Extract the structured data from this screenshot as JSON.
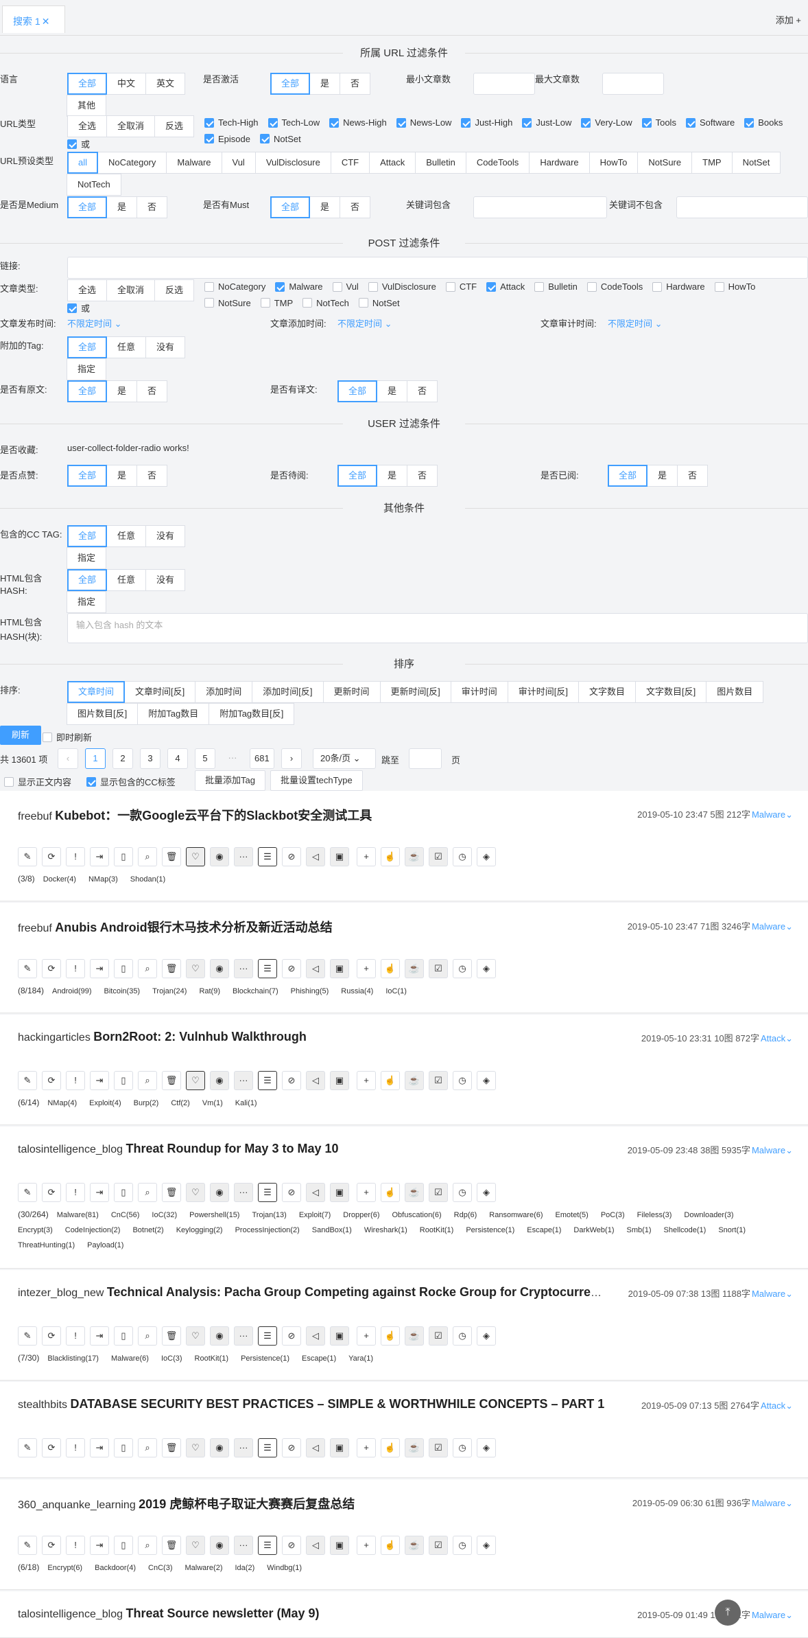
{
  "tab": {
    "label": "搜索 1",
    "close": "✕",
    "add": "添加 +"
  },
  "sections": {
    "url": "所属 URL 过滤条件",
    "post": "POST 过滤条件",
    "user": "USER 过滤条件",
    "other": "其他条件",
    "sort": "排序"
  },
  "url": {
    "lang_label": "语言",
    "lang": [
      "全部",
      "中文",
      "英文",
      "其他"
    ],
    "active_label": "是否激活",
    "active": [
      "全部",
      "是",
      "否"
    ],
    "min_label": "最小文章数",
    "max_label": "最大文章数",
    "type_label": "URL类型",
    "type_btns": [
      "全选",
      "全取消",
      "反选"
    ],
    "types": [
      "Tech-High",
      "Tech-Low",
      "News-High",
      "News-Low",
      "Just-High",
      "Just-Low",
      "Very-Low",
      "Tools",
      "Software",
      "Books",
      "Episode",
      "NotSet"
    ],
    "or": "或",
    "preset_label": "URL预设类型",
    "presets": [
      "all",
      "NoCategory",
      "Malware",
      "Vul",
      "VulDisclosure",
      "CTF",
      "Attack",
      "Bulletin",
      "CodeTools",
      "Hardware",
      "HowTo",
      "NotSure",
      "TMP",
      "NotSet",
      "NotTech"
    ],
    "medium_label": "是否是Medium",
    "medium": [
      "全部",
      "是",
      "否"
    ],
    "must_label": "是否有Must",
    "must": [
      "全部",
      "是",
      "否"
    ],
    "kw_in_label": "关键词包含",
    "kw_out_label": "关键词不包含"
  },
  "post": {
    "link_label": "链接:",
    "type_label": "文章类型:",
    "type_btns": [
      "全选",
      "全取消",
      "反选"
    ],
    "types": [
      "NoCategory",
      "Malware",
      "Vul",
      "VulDisclosure",
      "CTF",
      "Attack",
      "Bulletin",
      "CodeTools",
      "Hardware",
      "HowTo",
      "NotSure",
      "TMP",
      "NotTech",
      "NotSet"
    ],
    "or": "或",
    "pub_label": "文章发布时间:",
    "add_label": "文章添加时间:",
    "audit_label": "文章审计时间:",
    "unlimited": "不限定时间",
    "tag_label": "附加的Tag:",
    "tag": [
      "全部",
      "任意",
      "没有",
      "指定"
    ],
    "orig_label": "是否有原文:",
    "orig": [
      "全部",
      "是",
      "否"
    ],
    "trans_label": "是否有译文:",
    "trans": [
      "全部",
      "是",
      "否"
    ]
  },
  "user": {
    "collect_label": "是否收藏:",
    "collect_text": "user-collect-folder-radio works!",
    "like_label": "是否点赞:",
    "like": [
      "全部",
      "是",
      "否"
    ],
    "todo_label": "是否待阅:",
    "todo": [
      "全部",
      "是",
      "否"
    ],
    "read_label": "是否已阅:",
    "read": [
      "全部",
      "是",
      "否"
    ]
  },
  "other": {
    "cc_label": "包含的CC TAG:",
    "cc": [
      "全部",
      "任意",
      "没有",
      "指定"
    ],
    "hash_label1": "HTML包含",
    "hash_label2": "HASH:",
    "hash": [
      "全部",
      "任意",
      "没有",
      "指定"
    ],
    "hashb_label1": "HTML包含",
    "hashb_label2": "HASH(块):",
    "hashb_placeholder": "输入包含 hash 的文本"
  },
  "sort": {
    "label": "排序:",
    "opts": [
      "文章时间",
      "文章时间[反]",
      "添加时间",
      "添加时间[反]",
      "更新时间",
      "更新时间[反]",
      "审计时间",
      "审计时间[反]",
      "文字数目",
      "文字数目[反]",
      "图片数目",
      "图片数目[反]",
      "附加Tag数目",
      "附加Tag数目[反]"
    ]
  },
  "actions": {
    "refresh": "刷新",
    "instant": "即时刷新",
    "total": "共 13601 项",
    "pages": [
      "1",
      "2",
      "3",
      "4",
      "5",
      "···",
      "681"
    ],
    "per_page": "20条/页",
    "jump": "跳至",
    "page_suffix": "页",
    "show_body": "显示正文内容",
    "show_cc": "显示包含的CC标签",
    "batch_tag": "批量添加Tag",
    "batch_tech": "批量设置techType"
  },
  "icons": [
    "✎",
    "⟳",
    "!",
    "⇥",
    "▯",
    "⌕",
    "🗑",
    "♡",
    "◉",
    "···",
    "☰",
    "⊘",
    "◁",
    "▣",
    "+",
    "☝",
    "☕",
    "☑",
    "◷",
    "◈"
  ],
  "posts": [
    {
      "source": "freebuf",
      "title": "Kubebot：一款Google云平台下的Slackbot安全测试工具",
      "date": "2019-05-10 23:47",
      "imgs": "5图",
      "words": "212字",
      "cat": "Malware",
      "count": "(3/8)",
      "tags": [
        "Docker(4)",
        "NMap(3)",
        "Shodan(1)"
      ]
    },
    {
      "source": "freebuf",
      "title": "Anubis Android银行木马技术分析及新近活动总结",
      "date": "2019-05-10 23:47",
      "imgs": "71图",
      "words": "3246字",
      "cat": "Malware",
      "count": "(8/184)",
      "tags": [
        "Android(99)",
        "Bitcoin(35)",
        "Trojan(24)",
        "Rat(9)",
        "Blockchain(7)",
        "Phishing(5)",
        "Russia(4)",
        "IoC(1)"
      ]
    },
    {
      "source": "hackingarticles",
      "title": "Born2Root: 2: Vulnhub Walkthrough",
      "date": "2019-05-10 23:31",
      "imgs": "10图",
      "words": "872字",
      "cat": "Attack",
      "count": "(6/14)",
      "tags": [
        "NMap(4)",
        "Exploit(4)",
        "Burp(2)",
        "Ctf(2)",
        "Vm(1)",
        "Kali(1)"
      ]
    },
    {
      "source": "talosintelligence_blog",
      "title": "Threat Roundup for May 3 to May 10",
      "date": "2019-05-09 23:48",
      "imgs": "38图",
      "words": "5935字",
      "cat": "Malware",
      "count": "(30/264)",
      "tags": [
        "Malware(81)",
        "CnC(56)",
        "IoC(32)",
        "Powershell(15)",
        "Trojan(13)",
        "Exploit(7)",
        "Dropper(6)",
        "Obfuscation(6)",
        "Rdp(6)",
        "Ransomware(6)",
        "Emotet(5)",
        "PoC(3)",
        "Fileless(3)",
        "Downloader(3)",
        "Encrypt(3)",
        "CodeInjection(2)",
        "Botnet(2)",
        "Keylogging(2)",
        "ProcessInjection(2)",
        "SandBox(1)",
        "Wireshark(1)",
        "RootKit(1)",
        "Persistence(1)",
        "Escape(1)",
        "DarkWeb(1)",
        "Smb(1)",
        "Shellcode(1)",
        "Snort(1)",
        "ThreatHunting(1)",
        "Payload(1)"
      ]
    },
    {
      "source": "intezer_blog_new",
      "title": "Technical Analysis: Pacha Group Competing against Rocke Group for Cryptocurrency Mining Dominance in the Linux Cloud",
      "date": "2019-05-09 07:38",
      "imgs": "13图",
      "words": "1188字",
      "cat": "Malware",
      "count": "(7/30)",
      "tags": [
        "Blacklisting(17)",
        "Malware(6)",
        "IoC(3)",
        "RootKit(1)",
        "Persistence(1)",
        "Escape(1)",
        "Yara(1)"
      ]
    },
    {
      "source": "stealthbits",
      "title": "DATABASE SECURITY BEST PRACTICES – SIMPLE & WORTHWHILE CONCEPTS – PART 1",
      "date": "2019-05-09 07:13",
      "imgs": "5图",
      "words": "2764字",
      "cat": "Attack",
      "count": "",
      "tags": []
    },
    {
      "source": "360_anquanke_learning",
      "title": "2019 虎鲸杯电子取证大赛赛后复盘总结",
      "date": "2019-05-09 06:30",
      "imgs": "61图",
      "words": "936字",
      "cat": "Malware",
      "count": "(6/18)",
      "tags": [
        "Encrypt(6)",
        "Backdoor(4)",
        "CnC(3)",
        "Malware(2)",
        "Ida(2)",
        "Windbg(1)"
      ]
    },
    {
      "source": "talosintelligence_blog",
      "title": "Threat Source newsletter (May 9)",
      "date": "2019-05-09 01:49",
      "imgs": "1图",
      "words": "571字",
      "cat": "Malware",
      "count": "",
      "tags": []
    }
  ]
}
